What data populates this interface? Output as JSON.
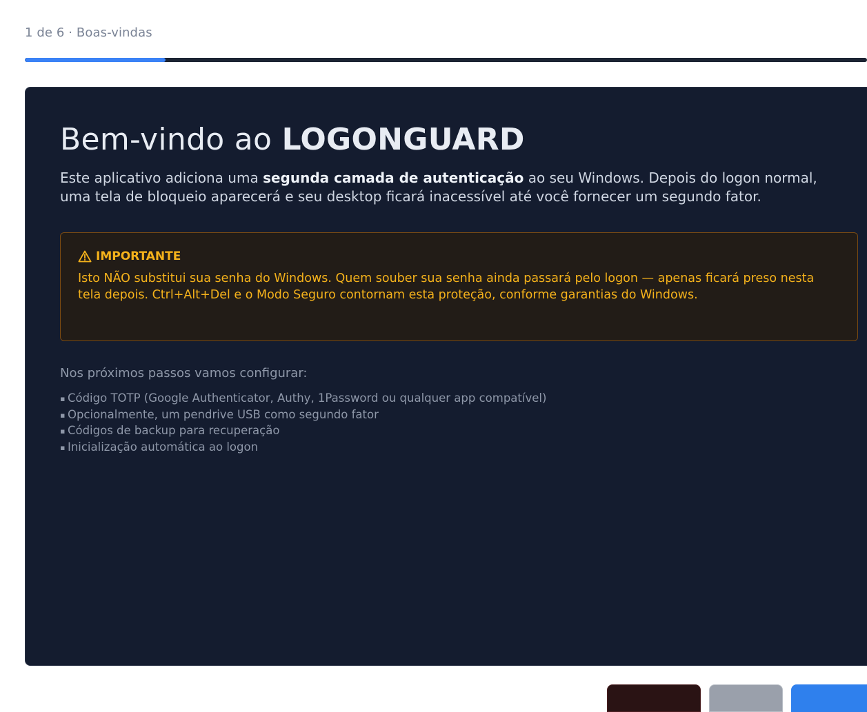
{
  "step": {
    "label": "1 de 6 · Boas-vindas",
    "progress_fraction": 0.1667
  },
  "welcome": {
    "title_prefix": "Bem-vindo ao ",
    "brand_name": "LOGONGUARD",
    "intro_part1": "Este aplicativo adiciona uma ",
    "intro_bold": "segunda camada de autenticação",
    "intro_part2": " ao seu Windows. Depois do logon normal, uma tela de bloqueio aparecerá e seu desktop ficará inacessível até você fornecer um segundo fator."
  },
  "warning": {
    "heading": "IMPORTANTE",
    "text": "Isto NÃO substitui sua senha do Windows. Quem souber sua senha ainda passará pelo logon — apenas ficará preso nesta tela depois. Ctrl+Alt+Del e o Modo Seguro contornam esta proteção, conforme garantias do Windows.",
    "icon": "warning-triangle-icon",
    "color": "#f5b21b"
  },
  "next_steps": {
    "intro": "Nos próximos passos vamos configurar:",
    "items": [
      "Código TOTP (Google Authenticator, Authy, 1Password ou qualquer app compatível)",
      "Opcionalmente, um pendrive USB como segundo fator",
      "Códigos de backup para recuperação",
      "Inicialização automática ao logon"
    ]
  },
  "footer": {
    "cancel_label": "",
    "back_label": "",
    "next_label": "",
    "accent_color": "#2f80ed"
  }
}
